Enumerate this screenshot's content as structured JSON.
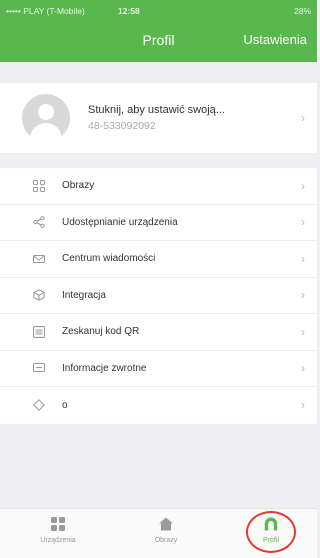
{
  "statusbar": {
    "carrier": "••••• PLAY (T-Mobile)",
    "time": "12:58",
    "battery": "28%"
  },
  "navbar": {
    "title": "Profil",
    "right_label": "Ustawienia"
  },
  "profile": {
    "name": "Stuknij, aby ustawić swoją...",
    "phone": "48-533092092"
  },
  "menu": [
    {
      "label": "Obrazy",
      "icon": "grid-icon"
    },
    {
      "label": "Udostępnianie urządzenia",
      "icon": "share-icon"
    },
    {
      "label": "Centrum wiadomości",
      "icon": "envelope-icon"
    },
    {
      "label": "Integracja",
      "icon": "cube-icon"
    },
    {
      "label": "Zeskanuj kod QR",
      "icon": "scan-icon"
    },
    {
      "label": "Informacje zwrotne",
      "icon": "feedback-icon"
    },
    {
      "label": "o",
      "icon": "diamond-icon"
    }
  ],
  "tabbar": {
    "tabs": [
      {
        "label": "Urządzenia",
        "icon": "devices-grid-icon"
      },
      {
        "label": "Obrazy",
        "icon": "home-icon"
      },
      {
        "label": "Profil",
        "icon": "profile-icon",
        "active": true
      }
    ]
  },
  "colors": {
    "brand_green": "#59b84d",
    "highlight_red": "#e53935"
  }
}
